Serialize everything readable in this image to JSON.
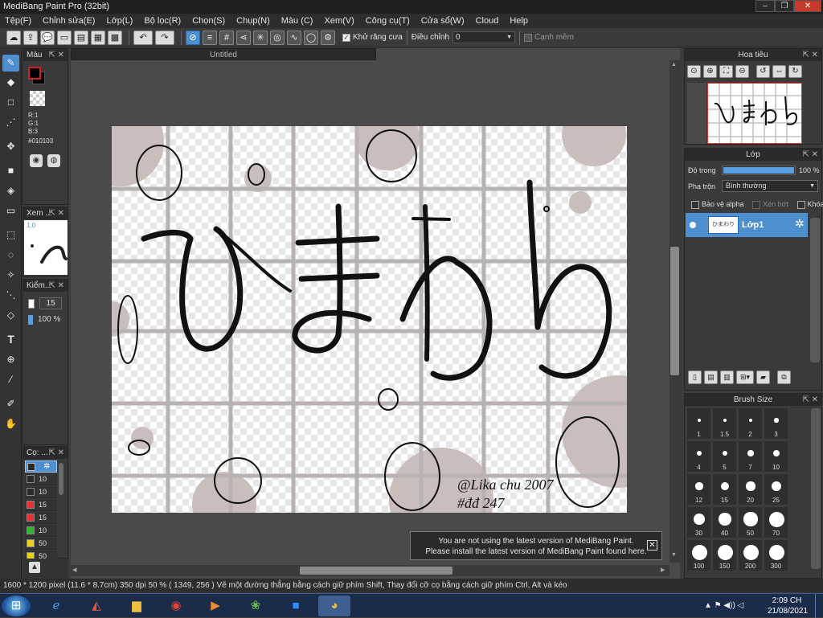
{
  "window": {
    "title": "MediBang Paint Pro (32bit)"
  },
  "menu": [
    "Tệp(F)",
    "Chỉnh sửa(E)",
    "Lớp(L)",
    "Bộ lọc(R)",
    "Chọn(S)",
    "Chụp(N)",
    "Màu (C)",
    "Xem(V)",
    "Công cụ(T)",
    "Cửa sổ(W)",
    "Cloud",
    "Help"
  ],
  "toolbar": {
    "antialias_label": "Khử răng cưa",
    "adjust_label": "Điều chỉnh",
    "adjust_value": "0",
    "soft_edge_label": "Cạnh mềm"
  },
  "panels": {
    "color": {
      "title": "Màu",
      "r": "R:1",
      "g": "G:1",
      "b": "B:3",
      "hex": "#010103"
    },
    "preview": {
      "title": "Xem ...",
      "value": "1.0"
    },
    "check": {
      "title": "Kiểm...",
      "size": "15",
      "opacity": "100 %"
    },
    "brush_list": {
      "title": "Cọ: ...",
      "sizes": [
        "10",
        "10",
        "15",
        "15",
        "10",
        "50",
        "50"
      ],
      "colors": [
        "#2a2a2a",
        "#2a2a2a",
        "#e53333",
        "#e53333",
        "#2db52d",
        "#e6d21a",
        "#e6d21a"
      ]
    },
    "navigator": {
      "title": "Hoa tiêu"
    },
    "layer": {
      "title": "Lớp",
      "opacity_label": "Độ trong",
      "opacity_value": "100 %",
      "opacity_fraction": 1.0,
      "blend_label": "Pha trộn",
      "blend_value": "Bình thường",
      "alpha_label": "Bảo vệ alpha",
      "clip_label": "Xén bớt",
      "lock_label": "Khóa",
      "layer_name": "Lớp1"
    },
    "brush_size": {
      "title": "Brush Size",
      "sizes": [
        "1",
        "1.5",
        "2",
        "3",
        "4",
        "5",
        "7",
        "10",
        "12",
        "15",
        "20",
        "25",
        "30",
        "40",
        "50",
        "70",
        "100",
        "150",
        "200",
        "300"
      ]
    }
  },
  "document": {
    "tab_title": "Untitled",
    "signature_line1": "@Lika chu 2007",
    "signature_line2": "#đđ 247"
  },
  "notification": {
    "line1": "You are not using the latest version of MediBang Paint.",
    "line2": "Please install the latest version of MediBang Paint found here."
  },
  "status": "1600 * 1200 pixel   (11.6 * 8.7cm)   350 dpi   50 %   ( 1349, 256 )   Vẽ một đường thẳng bằng cách giữ phím Shift, Thay đổi cỡ cọ bằng cách giữ phím Ctrl, Alt và kéo",
  "taskbar": {
    "time": "2:09 CH",
    "date": "21/08/2021"
  },
  "colors": {
    "accent": "#4d8fcf",
    "primary_color": "#010103",
    "grid": "#b9b2b2",
    "blob": "#c9bebc"
  }
}
